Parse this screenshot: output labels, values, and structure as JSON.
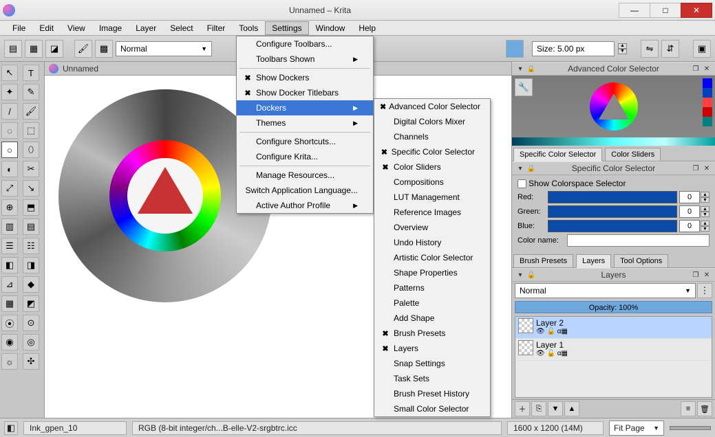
{
  "window": {
    "title": "Unnamed – Krita"
  },
  "menu": {
    "items": [
      "File",
      "Edit",
      "View",
      "Image",
      "Layer",
      "Select",
      "Filter",
      "Tools",
      "Settings",
      "Window",
      "Help"
    ],
    "open": "Settings"
  },
  "settings_menu": [
    {
      "label": "Configure Toolbars..."
    },
    {
      "label": "Toolbars Shown",
      "sub": true
    },
    {
      "sep": true
    },
    {
      "label": "Show Dockers",
      "checked": true
    },
    {
      "label": "Show Docker Titlebars",
      "checked": true
    },
    {
      "label": "Dockers",
      "sub": true,
      "hl": true
    },
    {
      "label": "Themes",
      "sub": true
    },
    {
      "sep": true
    },
    {
      "label": "Configure Shortcuts..."
    },
    {
      "label": "Configure Krita..."
    },
    {
      "sep": true
    },
    {
      "label": "Manage Resources..."
    },
    {
      "label": "Switch Application Language..."
    },
    {
      "label": "Active Author Profile",
      "sub": true
    }
  ],
  "dockers_submenu": [
    {
      "label": "Advanced Color Selector",
      "checked": true
    },
    {
      "label": "Digital Colors Mixer"
    },
    {
      "label": "Channels"
    },
    {
      "label": "Specific Color Selector",
      "checked": true
    },
    {
      "label": "Color Sliders",
      "checked": true
    },
    {
      "label": "Compositions"
    },
    {
      "label": "LUT Management"
    },
    {
      "label": "Reference Images"
    },
    {
      "label": "Overview"
    },
    {
      "label": "Undo History"
    },
    {
      "label": "Artistic Color Selector"
    },
    {
      "label": "Shape Properties"
    },
    {
      "label": "Patterns"
    },
    {
      "label": "Palette"
    },
    {
      "label": "Add Shape"
    },
    {
      "label": "Brush Presets",
      "checked": true
    },
    {
      "label": "Layers",
      "checked": true
    },
    {
      "label": "Snap Settings"
    },
    {
      "label": "Task Sets"
    },
    {
      "label": "Brush Preset History"
    },
    {
      "label": "Small Color Selector"
    }
  ],
  "toolbar": {
    "blend_mode": "Normal",
    "size_label": "Size:  5.00 px"
  },
  "canvas_tab": {
    "name": "Unnamed"
  },
  "panels": {
    "acs_title": "Advanced Color Selector",
    "scs_tab1": "Specific Color Selector",
    "scs_tab2": "Color Sliders",
    "scs_title": "Specific Color Selector",
    "showcs": "Show Colorspace Selector",
    "red": "Red:",
    "green": "Green:",
    "blue": "Blue:",
    "rval": "0",
    "gval": "0",
    "bval": "0",
    "colorname": "Color name:",
    "tabs": {
      "brush": "Brush Presets",
      "layers": "Layers",
      "opts": "Tool Options"
    },
    "layers_title": "Layers",
    "blend": "Normal",
    "opacity_label": "Opacity:  100%",
    "layer2": "Layer 2",
    "layer1": "Layer 1"
  },
  "status": {
    "brush": "Ink_gpen_10",
    "profile": "RGB (8-bit integer/ch...B-elle-V2-srgbtrc.icc",
    "dims": "1600 x 1200 (14M)",
    "zoom": "Fit Page"
  }
}
